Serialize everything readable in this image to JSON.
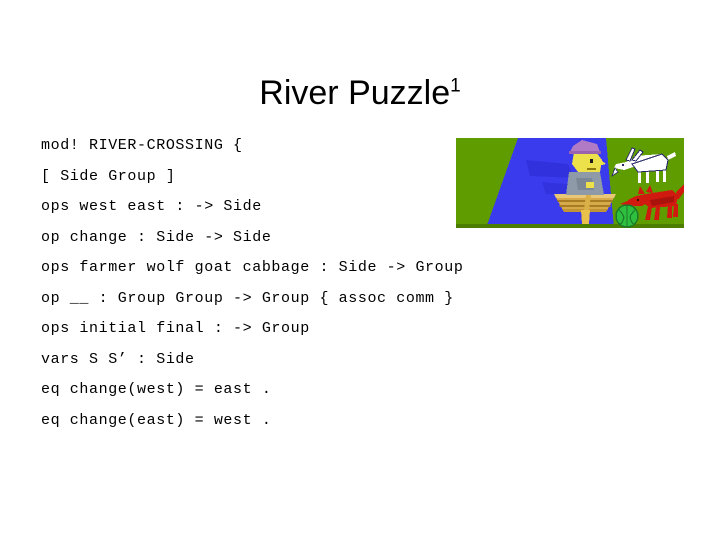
{
  "slide": {
    "title_text": "River Puzzle",
    "title_superscript": "1",
    "background_color": "#ffffff",
    "text_color": "#000000"
  },
  "code": {
    "language": "Maude",
    "lines": [
      "mod! RIVER-CROSSING {",
      "[ Side Group ]",
      "ops west east : -> Side",
      "op change : Side -> Side",
      "ops farmer wolf goat cabbage : Side -> Group",
      "op __ : Group Group -> Group { assoc comm }",
      "ops initial final : -> Group",
      "vars S S’ : Side",
      "eq change(west) = east .",
      "eq change(east) = west ."
    ]
  },
  "illustration": {
    "name": "river-crossing-cartoon",
    "alt": "Farmer rowing a boat across a blue river, with a goat, a wolf and a cabbage on the far green bank",
    "colors": {
      "grass": "#5f9c00",
      "grass_dark": "#4a7d00",
      "river": "#3b3bee",
      "river_shadow": "#2a2ad0",
      "boat": "#d6a94a",
      "boat_dark": "#a87c22",
      "oar": "#e8c24a",
      "hat": "#b07ac4",
      "face": "#ece14a",
      "shirt": "#8e9aa8",
      "goat": "#ffffff",
      "goat_outline": "#2a2a6a",
      "wolf": "#d01a10",
      "wolf_dark": "#8a0f08",
      "cabbage": "#2fbf3f",
      "cabbage_dark": "#1b7a28"
    },
    "figures": [
      {
        "name": "farmer-in-boat",
        "side": "river"
      },
      {
        "name": "goat",
        "side": "east"
      },
      {
        "name": "wolf",
        "side": "east"
      },
      {
        "name": "cabbage",
        "side": "east"
      }
    ]
  }
}
